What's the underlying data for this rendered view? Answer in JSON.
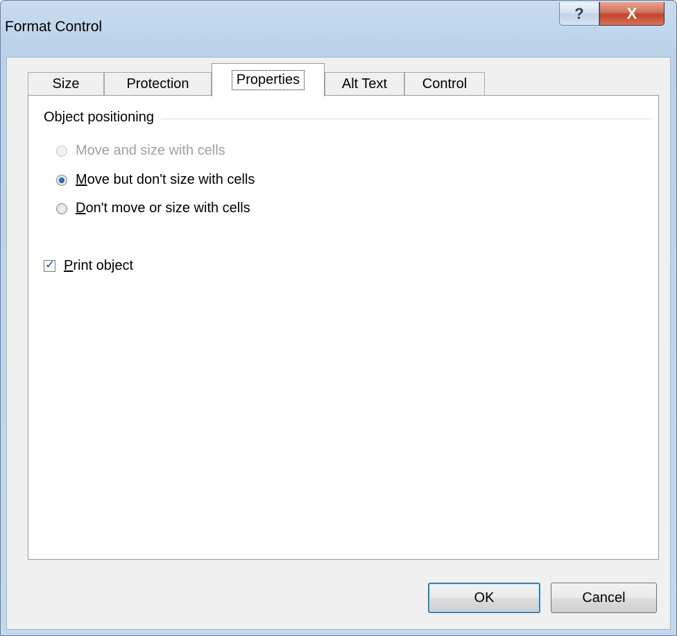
{
  "window": {
    "title": "Format Control",
    "help_glyph": "?",
    "close_glyph": "X"
  },
  "tabs": [
    {
      "label": "Size",
      "selected": false
    },
    {
      "label": "Protection",
      "selected": false
    },
    {
      "label": "Properties",
      "selected": true
    },
    {
      "label": "Alt Text",
      "selected": false
    },
    {
      "label": "Control",
      "selected": false
    }
  ],
  "properties": {
    "group_label": "Object positioning",
    "options": [
      {
        "label": "Move and size with cells",
        "accel": "",
        "rest": "Move and size with cells",
        "checked": false,
        "disabled": true
      },
      {
        "label": "Move but don't size with cells",
        "accel": "M",
        "rest": "ove but don't size with cells",
        "checked": true,
        "disabled": false
      },
      {
        "label": "Don't move or size with cells",
        "accel": "D",
        "rest": "on't move or size with cells",
        "checked": false,
        "disabled": false
      }
    ],
    "print_object": {
      "accel": "P",
      "rest": "rint object",
      "checked": true
    }
  },
  "buttons": {
    "ok": "OK",
    "cancel": "Cancel"
  },
  "colors": {
    "title_gradient": "#b9d1ea",
    "close_red": "#c1442a",
    "accent_blue": "#3c7fb1"
  }
}
